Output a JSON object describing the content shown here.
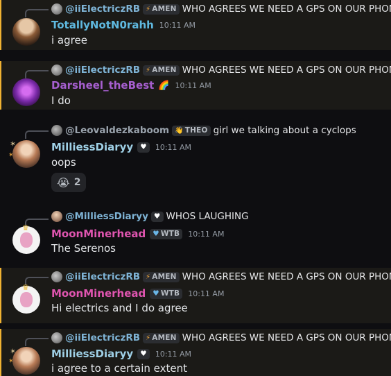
{
  "messages": [
    {
      "highlighted": true,
      "reply": {
        "author": "@iiElectriczRB",
        "tag": "AMEN",
        "tag_icon": "lightning-icon",
        "text": "WHO AGREES WE NEED A GPS ON OUR PHONES"
      },
      "author": "TotallyNotN0rahh",
      "author_color": "#5fb9e0",
      "time": "10:11 AM",
      "text": "i agree"
    },
    {
      "highlighted": true,
      "reply": {
        "author": "@iiElectriczRB",
        "tag": "AMEN",
        "tag_icon": "lightning-icon",
        "text": "WHO AGREES WE NEED A GPS ON OUR PHONES"
      },
      "author": "Darsheel_theBest",
      "author_color": "#a65fcf",
      "author_badge": "🌈",
      "time": "10:11 AM",
      "text": "I do"
    },
    {
      "highlighted": false,
      "reply": {
        "author": "@Leovaldezkaboom",
        "tag": "THEO",
        "tag_icon": "hand-icon",
        "text": "girl we talking about a cyclops"
      },
      "author": "MilliessDiaryy",
      "author_color": "#9fd0e6",
      "author_tag_icon": "heart-icon",
      "time": "10:11 AM",
      "text": "oops",
      "reaction": {
        "emoji": "😭",
        "count": "2"
      }
    },
    {
      "highlighted": false,
      "reply": {
        "author": "@MilliessDiaryy",
        "tag": "",
        "tag_icon": "heart-icon",
        "text": "WHOS LAUGHING"
      },
      "author": "MoonMinerhead",
      "author_color": "#e055b0",
      "author_tag": "WTB",
      "author_tag_icon": "heart-icon",
      "time": "10:11 AM",
      "text": "The Serenos"
    },
    {
      "highlighted": true,
      "reply": {
        "author": "@iiElectriczRB",
        "tag": "AMEN",
        "tag_icon": "lightning-icon",
        "text": "WHO AGREES WE NEED A GPS ON OUR PHONES"
      },
      "author": "MoonMinerhead",
      "author_color": "#e055b0",
      "author_tag": "WTB",
      "author_tag_icon": "heart-icon",
      "time": "10:11 AM",
      "text": "Hi electrics and I do agree"
    },
    {
      "highlighted": true,
      "reply": {
        "author": "@iiElectriczRB",
        "tag": "AMEN",
        "tag_icon": "lightning-icon",
        "text": "WHO AGREES WE NEED A GPS ON OUR PHONES"
      },
      "author": "MilliessDiaryy",
      "author_color": "#9fd0e6",
      "author_tag_icon": "heart-icon",
      "time": "10:11 AM",
      "text": "i agree to a certain extent"
    }
  ]
}
